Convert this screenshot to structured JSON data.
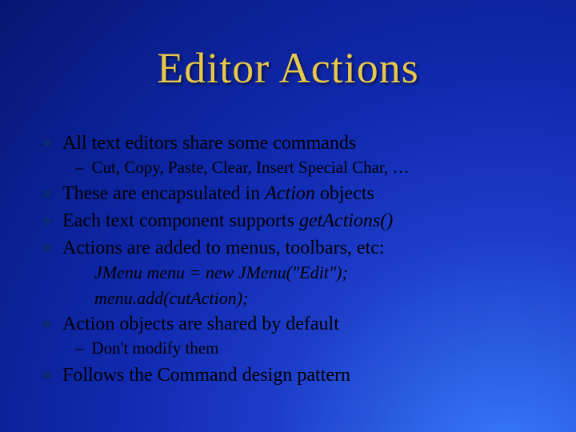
{
  "title": "Editor Actions",
  "bullets": {
    "b1": "All text editors share some commands",
    "b1_sub1": "Cut, Copy, Paste, Clear, Insert Special Char, …",
    "b2_pre": "These are encapsulated in ",
    "b2_ital": "Action",
    "b2_post": " objects",
    "b3_pre": "Each text component supports ",
    "b3_ital": "getActions()",
    "b4": "Actions are added to menus, toolbars, etc:",
    "code1": "JMenu menu = new JMenu(\"Edit\");",
    "code2": "menu.add(cutAction);",
    "b5": "Action objects are shared by default",
    "b5_sub1": "Don't modify them",
    "b6": "Follows the Command design pattern"
  }
}
